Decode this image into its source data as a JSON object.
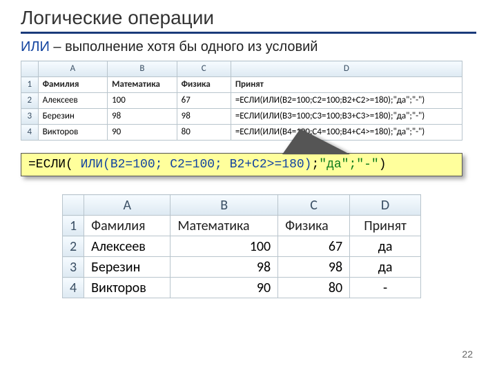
{
  "title": "Логические операции",
  "subtitle_kw": "ИЛИ",
  "subtitle_rest": " – выполнение хотя бы одного из условий",
  "page_number": "22",
  "sheet1": {
    "col_letters": [
      "A",
      "B",
      "C",
      "D"
    ],
    "row_numbers": [
      "1",
      "2",
      "3",
      "4"
    ],
    "header": [
      "Фамилия",
      "Математика",
      "Физика",
      "Принят"
    ],
    "rows": [
      [
        "Алексеев",
        "100",
        "67",
        "=ЕСЛИ(ИЛИ(B2=100;C2=100;B2+C2>=180);\"да\";\"-\")"
      ],
      [
        "Березин",
        "98",
        "98",
        "=ЕСЛИ(ИЛИ(B3=100;C3=100;B3+C3>=180);\"да\";\"-\")"
      ],
      [
        "Викторов",
        "90",
        "80",
        "=ЕСЛИ(ИЛИ(B4=100;C4=100;B4+C4>=180);\"да\";\"-\")"
      ]
    ]
  },
  "formula": {
    "p1": "=ЕСЛИ(",
    "p2": " ИЛИ(B2=100; C2=100; B2+C2>=180)",
    "p3": ";",
    "p4": "\"да\";\"-\"",
    "p5": ")"
  },
  "sheet2": {
    "col_letters": [
      "A",
      "B",
      "C",
      "D"
    ],
    "row_numbers": [
      "1",
      "2",
      "3",
      "4"
    ],
    "header": [
      "Фамилия",
      "Математика",
      "Физика",
      "Принят"
    ],
    "rows": [
      [
        "Алексеев",
        "100",
        "67",
        "да"
      ],
      [
        "Березин",
        "98",
        "98",
        "да"
      ],
      [
        "Викторов",
        "90",
        "80",
        "-"
      ]
    ]
  }
}
